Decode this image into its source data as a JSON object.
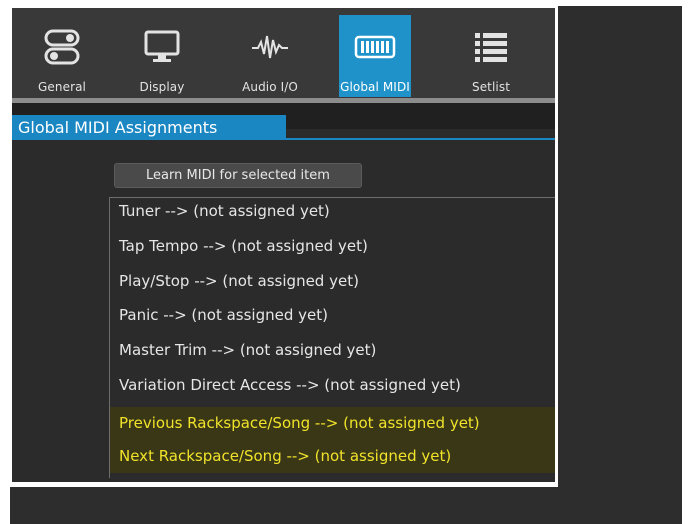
{
  "toolbar": {
    "tabs": [
      {
        "label": "General",
        "icon": "toggle-switches-icon"
      },
      {
        "label": "Display",
        "icon": "monitor-icon"
      },
      {
        "label": "Audio I/O",
        "icon": "waveform-icon"
      },
      {
        "label": "Global MIDI",
        "icon": "keyboard-icon",
        "active": true
      },
      {
        "label": "Setlist",
        "icon": "list-icon"
      }
    ]
  },
  "section": {
    "title": "Global MIDI Assignments"
  },
  "learn_button": {
    "label": "Learn MIDI for selected item"
  },
  "assignments": [
    {
      "text": "Tuner --> (not assigned yet)"
    },
    {
      "text": "Tap Tempo --> (not assigned yet)"
    },
    {
      "text": "Play/Stop --> (not assigned yet)"
    },
    {
      "text": "Panic --> (not assigned yet)"
    },
    {
      "text": "Master Trim --> (not assigned yet)"
    },
    {
      "text": "Variation Direct Access --> (not assigned yet)"
    },
    {
      "text": "Previous Rackspace/Song --> (not assigned yet)",
      "highlighted": true
    },
    {
      "text": "Next Rackspace/Song --> (not assigned yet)",
      "highlighted": true
    }
  ],
  "colors": {
    "accent": "#1f93c9",
    "highlight_text": "#f0e32a",
    "panel": "#2b2b2c"
  }
}
